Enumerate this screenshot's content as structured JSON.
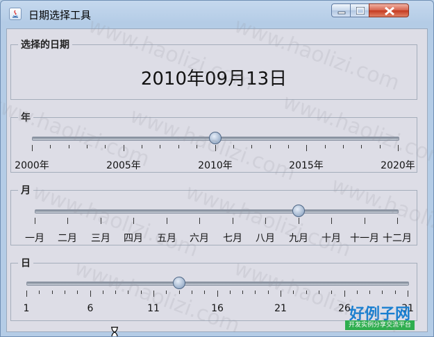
{
  "window": {
    "title": "日期选择工具",
    "controls": {
      "minimize": "minimize",
      "maximize": "maximize",
      "close": "close"
    }
  },
  "selected": {
    "title": "选择的日期",
    "value": "2010年09月13日"
  },
  "year": {
    "title": "年",
    "min": 2000,
    "max": 2020,
    "value": 2010,
    "major_step": 5,
    "minor_step": 1,
    "labels": [
      "2000年",
      "2005年",
      "2010年",
      "2015年",
      "2020年"
    ]
  },
  "month": {
    "title": "月",
    "min": 1,
    "max": 12,
    "value": 9,
    "labels": [
      "一月",
      "二月",
      "三月",
      "四月",
      "五月",
      "六月",
      "七月",
      "八月",
      "九月",
      "十月",
      "十一月",
      "十二月"
    ]
  },
  "day": {
    "title": "日",
    "min": 1,
    "max": 31,
    "value": 13,
    "major_step": 5,
    "minor_step": 1,
    "labels": [
      "1",
      "6",
      "11",
      "16",
      "21",
      "26",
      "31"
    ]
  },
  "watermark": "www.haolizi.com",
  "brand": {
    "main": "好例子网",
    "sub": "开发实例分享交流平台"
  },
  "icons": {
    "app": "java-icon",
    "cursor": "hourglass-icon"
  }
}
